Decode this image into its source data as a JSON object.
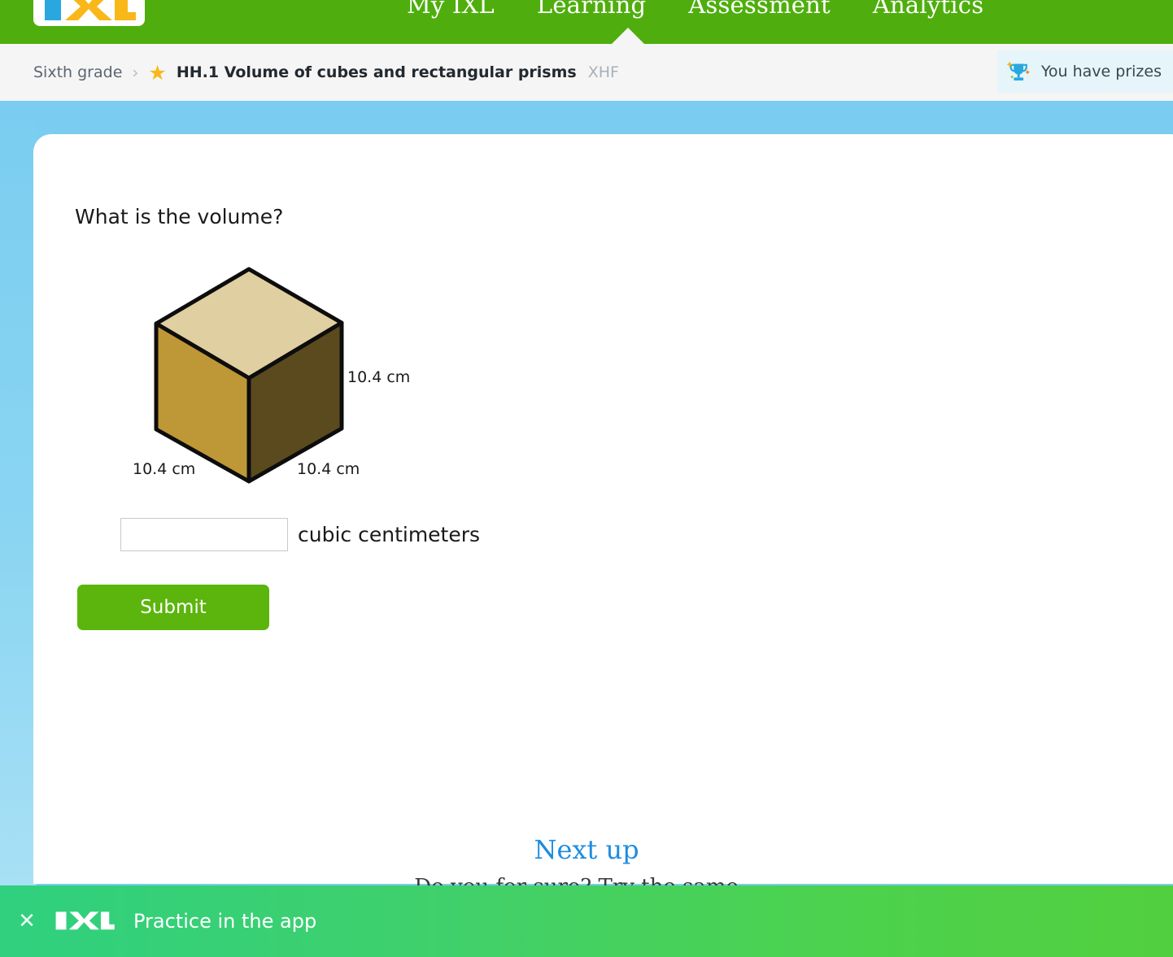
{
  "header": {
    "logo_alt": "IXL",
    "nav_items": [
      {
        "label": "My IXL"
      },
      {
        "label": "Learning"
      },
      {
        "label": "Assessment"
      },
      {
        "label": "Analytics"
      }
    ],
    "active_nav": "Learning"
  },
  "breadcrumb": {
    "grade": "Sixth grade",
    "separator": "›",
    "star": "★",
    "skill": "HH.1 Volume of cubes and rectangular prisms",
    "code": "XHF"
  },
  "prizes": {
    "label": "You have prizes",
    "icon": "trophy-icon"
  },
  "question": {
    "prompt": "What is the volume?",
    "unit_label": "cubic centimeters",
    "answer_value": "",
    "answer_placeholder": ""
  },
  "figure": {
    "shape": "cube",
    "label_right": "10.4 cm",
    "label_bottom_left": "10.4 cm",
    "label_bottom_right": "10.4 cm",
    "colors": {
      "top_face": "#e0cfa0",
      "left_face": "#be9836",
      "right_face": "#5a4a1e",
      "edge": "#0d0d0d"
    }
  },
  "actions": {
    "submit_label": "Submit"
  },
  "next_up": {
    "title": "Next up",
    "subtitle": "Do you for sure? Try the same..."
  },
  "app_bar": {
    "close_icon": "close-icon",
    "logo_alt": "IXL",
    "label": "Practice in the app"
  },
  "theme": {
    "nav_green": "#4fae0e",
    "page_blue": "#7acdf0",
    "submit_green": "#5bb50c",
    "link_blue": "#1e8ce0",
    "star_gold": "#f9b719"
  }
}
